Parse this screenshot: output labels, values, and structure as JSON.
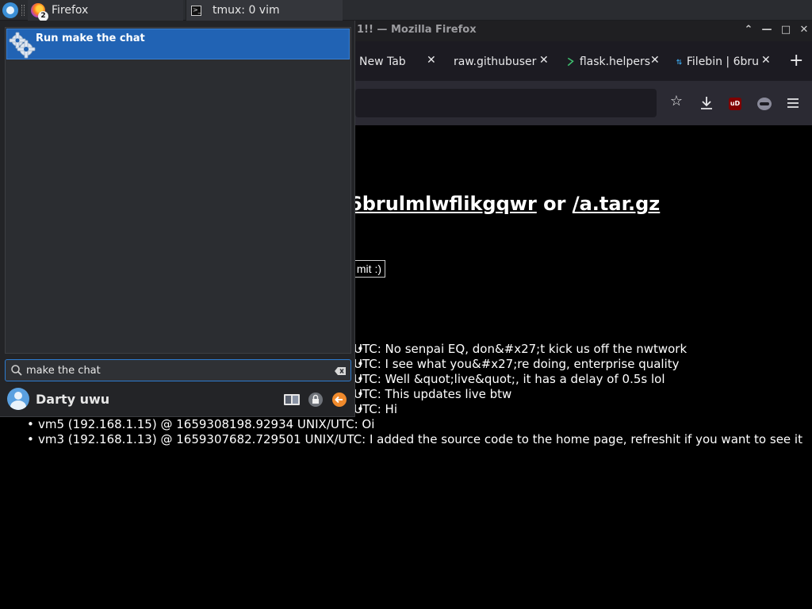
{
  "taskbar": {
    "firefox_label": "Firefox",
    "firefox_badge": "2",
    "tmux_label": "tmux: 0 vim"
  },
  "browser": {
    "window_title": "1!! — Mozilla Firefox",
    "tabs": [
      {
        "label": "New Tab",
        "icon": "none"
      },
      {
        "label": "raw.githubuserc",
        "icon": "none"
      },
      {
        "label": "flask.helpers",
        "icon": "flask-icon"
      },
      {
        "label": "Filebin | 6bru",
        "icon": "filebin-icon"
      }
    ],
    "new_tab_symbol": "+",
    "toolbar_icons": [
      "star-icon",
      "download-icon",
      "ublock-icon",
      "spy-icon",
      "hamburger-icon"
    ],
    "ublock_text": "uD"
  },
  "page": {
    "heading_link1": "6brulmlwflikgqwr",
    "heading_or": "or",
    "heading_link2": "/a.tar.gz",
    "submit_label": "mit :)",
    "chat": [
      "UTC: No senpai EQ, don&#x27;t kick us off the nwtwork",
      "UTC: I see what you&#x27;re doing, enterprise quality",
      "UTC: Well &quot;live&quot;, it has a delay of 0.5s lol",
      "UTC: This updates live btw",
      "UTC: Hi",
      "vm5 (192.168.1.15) @ 1659308198.92934 UNIX/UTC: Oi",
      "vm3 (192.168.1.13) @ 1659307682.729501 UNIX/UTC: I added the source code to the home page, refreshit if you want to see it"
    ]
  },
  "launcher": {
    "result_label": "Run make the chat",
    "search_value": "make the chat",
    "username": "Darty uwu",
    "colors": {
      "selection": "#2163b4",
      "accent": "#2d7bd0",
      "logout": "#f08a2c"
    }
  }
}
